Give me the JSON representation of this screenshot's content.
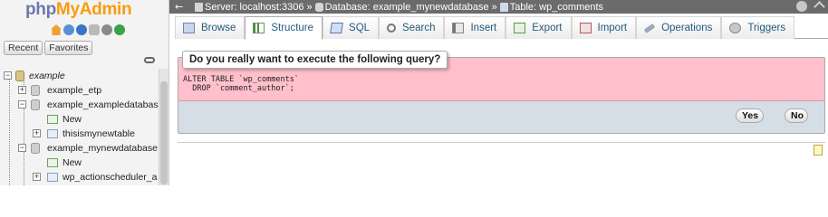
{
  "app": {
    "logo_php": "php",
    "logo_myadmin": "MyAdmin",
    "brand_colors": {
      "php": "#6c78af",
      "myadmin": "#f89c0e"
    }
  },
  "nav": {
    "icons": [
      "home-icon",
      "exit-icon",
      "help-icon",
      "docs-icon",
      "settings-icon",
      "reload-icon"
    ],
    "tabs": [
      "Recent",
      "Favorites"
    ],
    "tree": [
      {
        "label": "example",
        "level": 0,
        "expander": "−"
      },
      {
        "label": "example_etp",
        "level": 1,
        "expander": "+"
      },
      {
        "label": "example_exampledatabas",
        "level": 1,
        "expander": "−"
      },
      {
        "label": "New",
        "level": 2,
        "expander": ""
      },
      {
        "label": "thisismynewtable",
        "level": 2,
        "expander": "+"
      },
      {
        "label": "example_mynewdatabase",
        "level": 1,
        "expander": "−"
      },
      {
        "label": "New",
        "level": 2,
        "expander": ""
      },
      {
        "label": "wp_actionscheduler_a",
        "level": 2,
        "expander": "+"
      }
    ]
  },
  "topbar": {
    "server": "Server: localhost:3306",
    "database": "Database: example_mynewdatabase",
    "table": "Table: wp_comments",
    "separator": "»"
  },
  "tabs": [
    {
      "label": "Browse",
      "icon": "browse",
      "active": false
    },
    {
      "label": "Structure",
      "icon": "structure",
      "active": true
    },
    {
      "label": "SQL",
      "icon": "sql",
      "active": false
    },
    {
      "label": "Search",
      "icon": "search",
      "active": false
    },
    {
      "label": "Insert",
      "icon": "insert",
      "active": false
    },
    {
      "label": "Export",
      "icon": "export",
      "active": false
    },
    {
      "label": "Import",
      "icon": "import",
      "active": false
    },
    {
      "label": "Operations",
      "icon": "operations",
      "active": false
    },
    {
      "label": "Triggers",
      "icon": "triggers",
      "active": false
    }
  ],
  "confirm": {
    "legend": "Do you really want to execute the following query?",
    "query_line1": "ALTER TABLE `wp_comments`",
    "query_line2": "  DROP `comment_author`;",
    "yes_label": "Yes",
    "no_label": "No",
    "query_bg": "#ffc0cb"
  }
}
